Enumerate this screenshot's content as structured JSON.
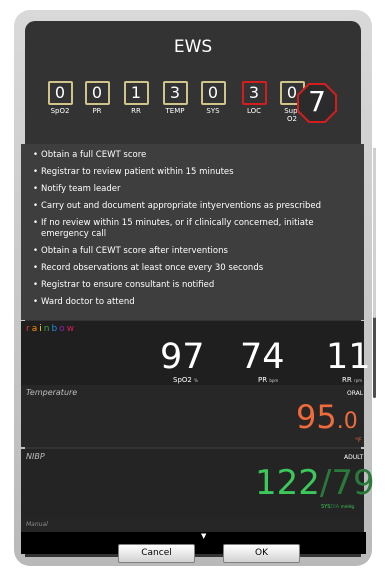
{
  "title": "EWS",
  "scores": [
    {
      "value": "0",
      "label": "SpO2",
      "color": "#cfc48a"
    },
    {
      "value": "0",
      "label": "PR",
      "color": "#cfc48a"
    },
    {
      "value": "1",
      "label": "RR",
      "color": "#cfc48a"
    },
    {
      "value": "3",
      "label": "TEMP",
      "color": "#cfc48a"
    },
    {
      "value": "0",
      "label": "SYS",
      "color": "#cfc48a"
    },
    {
      "value": "3",
      "label": "LOC",
      "color": "#d21e1e"
    },
    {
      "value": "0",
      "label": "Sup. O2",
      "color": "#cfc48a"
    }
  ],
  "total_score": "7",
  "instructions": [
    "Obtain a full CEWT score",
    "Registrar to review patient within 15 minutes",
    "Notify team leader",
    "Carry out and document appropriate intyerventions as prescribed",
    "If no review within 15 minutes, or if clinically concerned, initiate emergency call",
    "Obtain a full CEWT score after interventions",
    "Record observations at least once every 30 seconds",
    "Registrar to ensure consultant is notified",
    "Ward doctor to attend"
  ],
  "rainbow": {
    "label": "rainbow",
    "spo2": {
      "value": "97",
      "label": "SpO2",
      "unit": "%"
    },
    "pr": {
      "value": "74",
      "label": "PR",
      "unit": "bpm"
    },
    "rr": {
      "value": "11",
      "label": "RR",
      "unit": "rpm"
    }
  },
  "temperature": {
    "label": "Temperature",
    "site": "ORAL",
    "value_int": "95",
    "value_dec": ".0",
    "unit": "°F"
  },
  "nibp": {
    "label": "NIBP",
    "mode": "ADULT",
    "sys": "122",
    "sep": "/",
    "dia": "79",
    "sys_label": "SYS",
    "dia_label": "DIA",
    "unit": "mmHg"
  },
  "manual": {
    "label": "Manual"
  },
  "buttons": {
    "cancel": "Cancel",
    "ok": "OK"
  },
  "colors": {
    "temp": "#f06a3c",
    "nibp": "#3cc85a",
    "alert_red": "#d21e1e",
    "rainbow_letters": [
      "#e53935",
      "#fb8c00",
      "#fdd835",
      "#43a047",
      "#1e88e5",
      "#8e24aa",
      "#d81b60"
    ]
  }
}
